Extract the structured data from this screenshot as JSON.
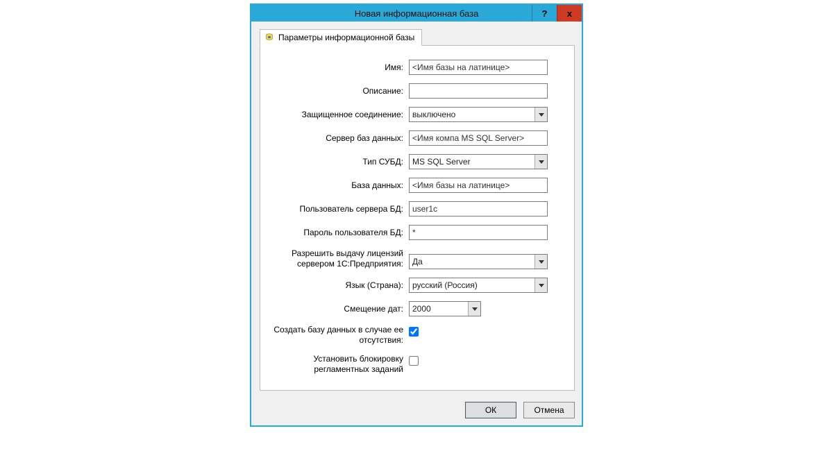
{
  "window": {
    "title": "Новая информационная база",
    "help_label": "?",
    "close_label": "x"
  },
  "tab": {
    "label": "Параметры информационной базы"
  },
  "form": {
    "name": {
      "label": "Имя:",
      "value": "<Имя базы на латинице>"
    },
    "description": {
      "label": "Описание:",
      "value": ""
    },
    "secure_conn": {
      "label": "Защищенное соединение:",
      "value": "выключено"
    },
    "db_server": {
      "label": "Сервер баз данных:",
      "value": "<Имя компа MS SQL Server>"
    },
    "dbms_type": {
      "label": "Тип СУБД:",
      "value": "MS SQL Server"
    },
    "database": {
      "label": "База данных:",
      "value": "<Имя базы на латинице>"
    },
    "db_user": {
      "label": "Пользователь сервера БД:",
      "value": "user1c"
    },
    "db_password": {
      "label": "Пароль пользователя БД:",
      "value": "*"
    },
    "allow_lic": {
      "label": "Разрешить выдачу лицензий сервером 1С:Предприятия:",
      "value": "Да"
    },
    "language": {
      "label": "Язык (Страна):",
      "value": "русский (Россия)"
    },
    "date_offset": {
      "label": "Смещение дат:",
      "value": "2000"
    },
    "create_if_missing": {
      "label": "Создать базу данных в случае ее отсутствия:",
      "checked": true
    },
    "block_jobs": {
      "label": "Установить блокировку регламентных заданий",
      "checked": false
    }
  },
  "footer": {
    "ok": "ОК",
    "cancel": "Отмена"
  }
}
